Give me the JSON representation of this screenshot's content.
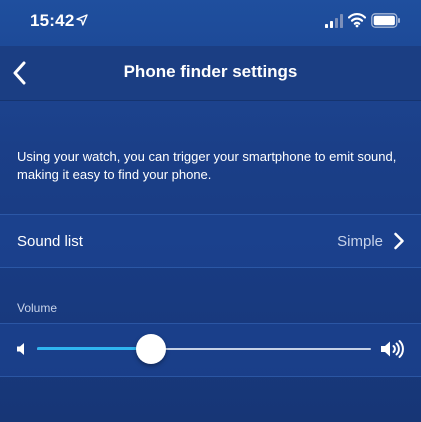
{
  "status_bar": {
    "time": "15:42",
    "location_icon": "location-arrow-icon",
    "signal_icon": "cellular-signal-icon",
    "wifi_icon": "wifi-icon",
    "battery_icon": "battery-icon"
  },
  "nav": {
    "back_icon": "chevron-left-icon",
    "title": "Phone finder settings"
  },
  "description": "Using your watch, you can trigger your smartphone to emit sound, making it easy to find your phone.",
  "sound_list": {
    "label": "Sound list",
    "value": "Simple",
    "chevron_icon": "chevron-right-icon"
  },
  "volume": {
    "section_label": "Volume",
    "level": 0.34,
    "low_icon": "volume-low-icon",
    "high_icon": "volume-high-icon"
  },
  "colors": {
    "background": "#1b3f88",
    "slider_fill": "#2fb5f0",
    "slider_track": "#c6d1e6",
    "secondary_text": "#c7d3ea"
  }
}
